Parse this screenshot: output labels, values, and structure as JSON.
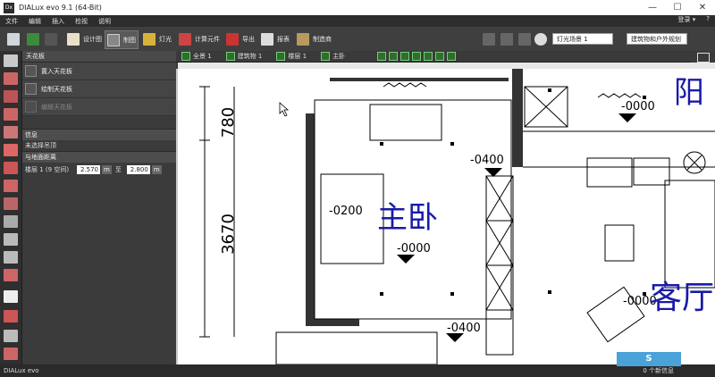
{
  "window": {
    "title": "DIALux evo 9.1  (64-Bit)",
    "app_icon_text": "Dx",
    "minimize": "—",
    "maximize": "☐",
    "close": "✕"
  },
  "menu": {
    "items": [
      "文件",
      "编辑",
      "插入",
      "检视",
      "说明"
    ],
    "right": [
      "登录 ▾",
      "?"
    ]
  },
  "toolbar": {
    "design": "设计图",
    "building": "制图",
    "light": "灯光",
    "calc": "计算元件",
    "export": "导出",
    "report": "报表",
    "docs": "制造商",
    "scene_select": "灯光场景 1",
    "plan_select": "建筑物和户外规划"
  },
  "left_panel": {
    "header": "天花板",
    "items": [
      {
        "label": "置入天花板",
        "enabled": true
      },
      {
        "label": "绘制天花板",
        "enabled": true
      },
      {
        "label": "编辑天花板",
        "enabled": false
      }
    ],
    "info_header": "信息",
    "info_text": "未选择吊顶",
    "floor_header": "与地面距离",
    "floor_label": "楼层 1 (9 空间)",
    "value1": "2.570",
    "unit1": "m",
    "between": "至",
    "value2": "2.800",
    "unit2": "m"
  },
  "view_tabs": {
    "all": "全景 1",
    "building": "建筑物 1",
    "floor": "楼层 1",
    "layer": "主卧"
  },
  "canvas": {
    "room_main": "主卧",
    "room_living": "客厅",
    "room_balcony": "阳",
    "dim_780": "780",
    "dim_3670": "3670",
    "lvl1": "-0000",
    "lvl2": "-0400",
    "lvl3": "-0200",
    "lvl4": "-0000",
    "lvl5": "-0400",
    "lvl6": "-0000"
  },
  "status": {
    "brand": "DIALux evo",
    "messages": "0 个新信息"
  },
  "watermark": "S"
}
